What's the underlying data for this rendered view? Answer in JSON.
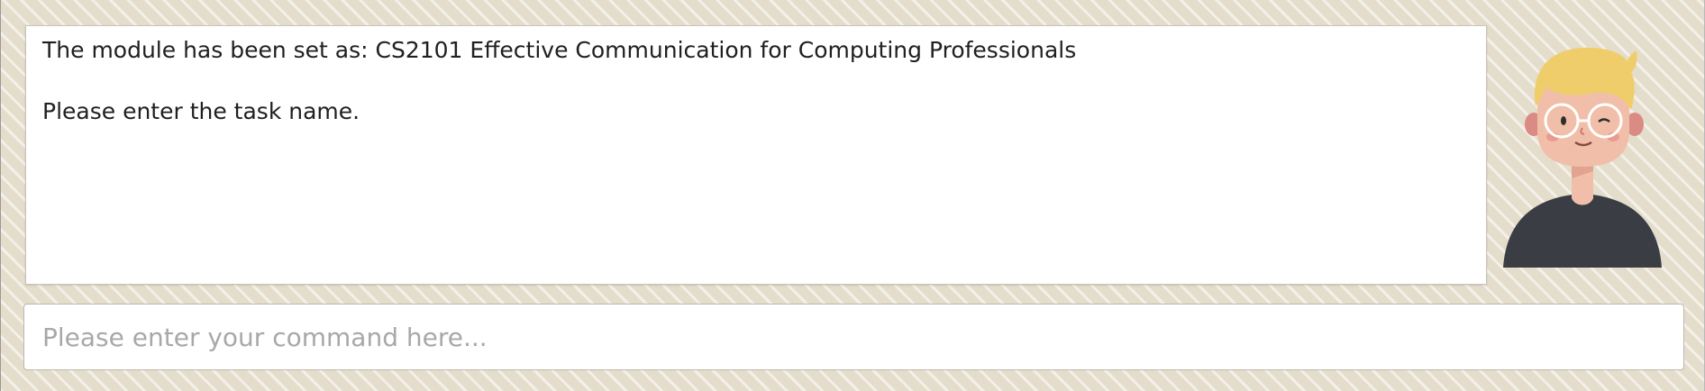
{
  "dialog": {
    "message": "The module has been set as: CS2101 Effective Communication for Computing Professionals\n\nPlease enter the task name."
  },
  "avatar": {
    "icon": "user-avatar-icon"
  },
  "command": {
    "value": "",
    "placeholder": "Please enter your command here..."
  },
  "colors": {
    "background": "#e4ddcc",
    "hair": "#f0cd6b",
    "skin": "#f1bfa9",
    "shirt": "#3a3d44"
  }
}
